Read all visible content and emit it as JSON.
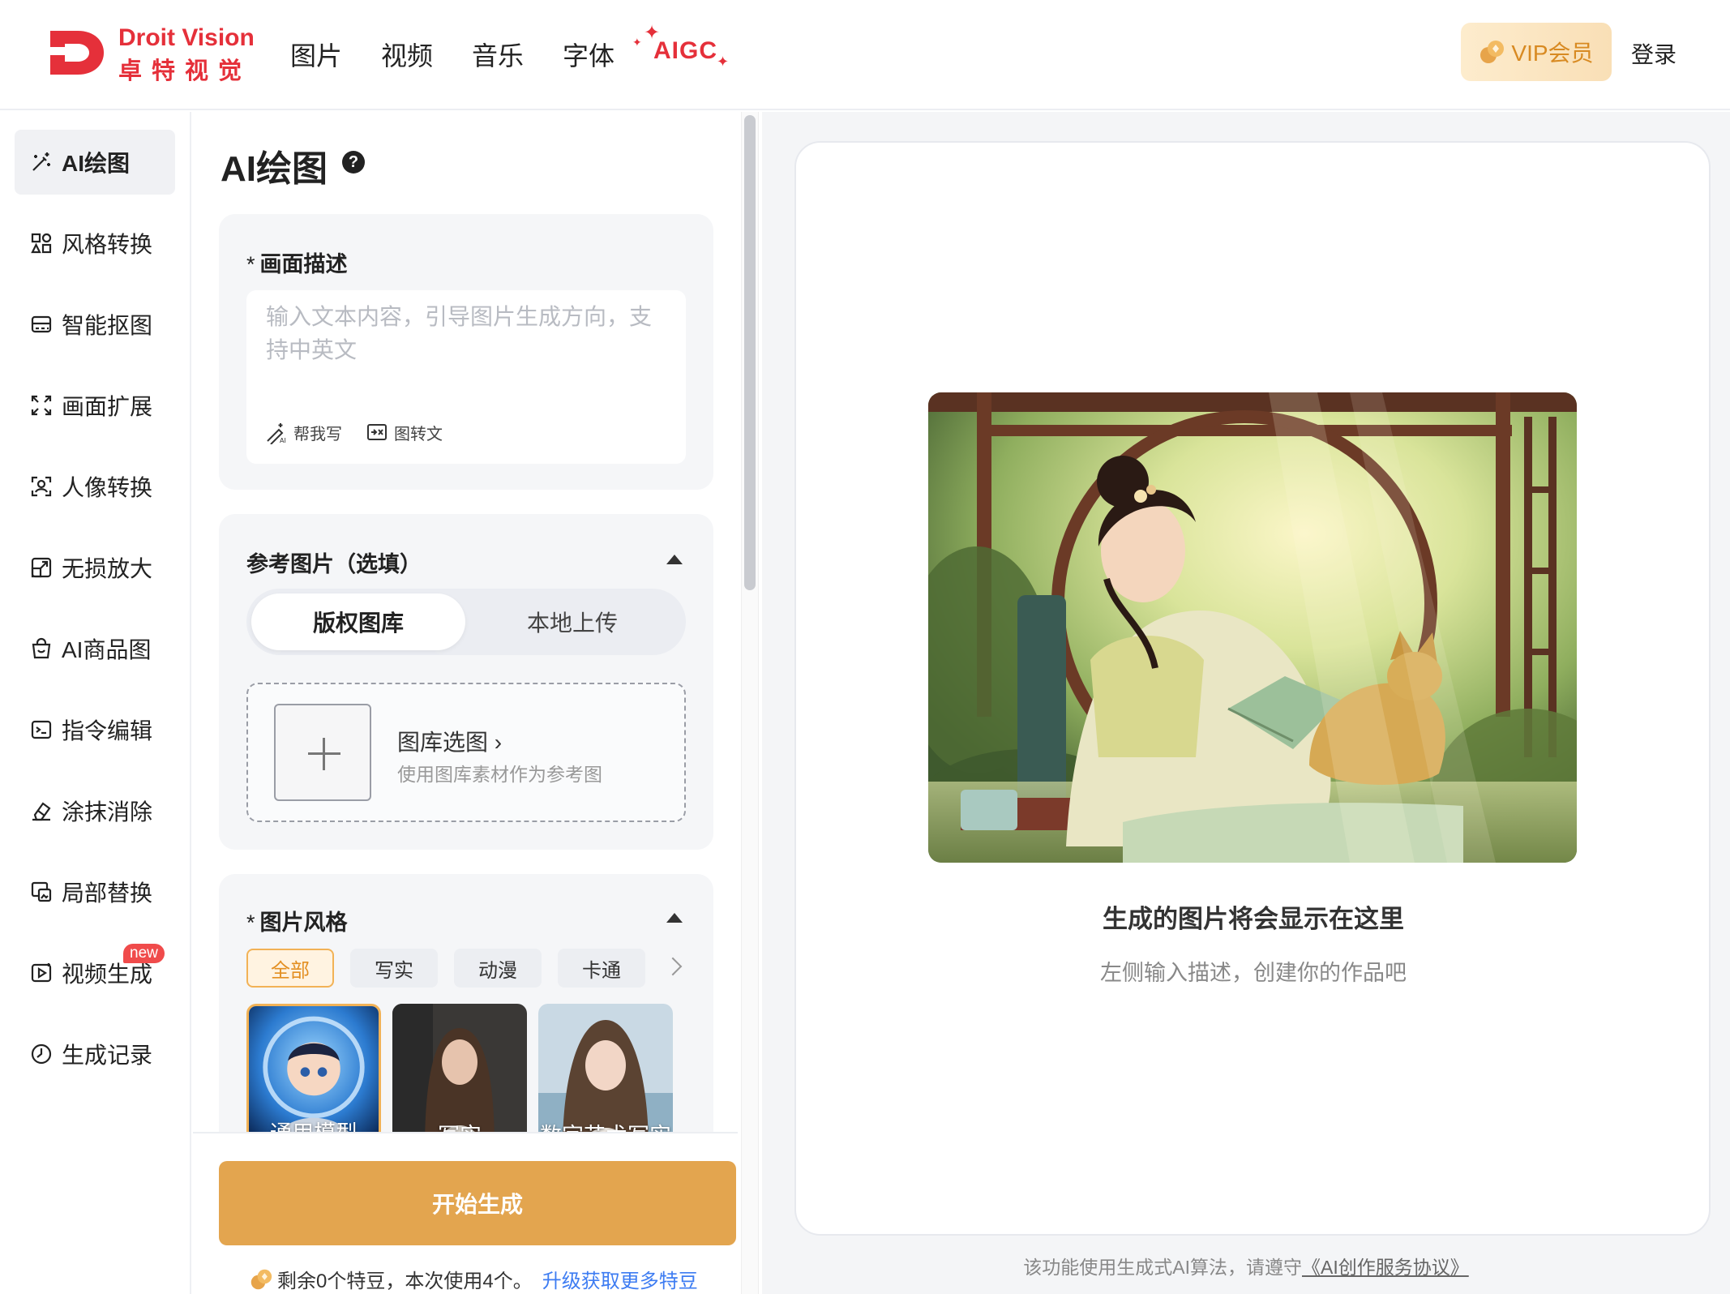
{
  "header": {
    "logo_en": "Droit Vision",
    "logo_cn": "卓特视觉",
    "nav": [
      {
        "label": "图片"
      },
      {
        "label": "视频"
      },
      {
        "label": "音乐"
      },
      {
        "label": "字体"
      }
    ],
    "aigc_label": "AIGC",
    "vip_label": "VIP会员",
    "login_label": "登录"
  },
  "sidebar": {
    "items": [
      {
        "label": "AI绘图",
        "icon": "magic-wand-icon",
        "active": true
      },
      {
        "label": "风格转换",
        "icon": "grid-style-icon"
      },
      {
        "label": "智能抠图",
        "icon": "cutout-icon"
      },
      {
        "label": "画面扩展",
        "icon": "expand-icon"
      },
      {
        "label": "人像转换",
        "icon": "portrait-scan-icon"
      },
      {
        "label": "无损放大",
        "icon": "upscale-icon"
      },
      {
        "label": "AI商品图",
        "icon": "shopping-bag-icon"
      },
      {
        "label": "指令编辑",
        "icon": "terminal-icon"
      },
      {
        "label": "涂抹消除",
        "icon": "eraser-icon"
      },
      {
        "label": "局部替换",
        "icon": "image-replace-icon"
      },
      {
        "label": "视频生成",
        "icon": "video-play-icon",
        "badge": "new"
      },
      {
        "label": "生成记录",
        "icon": "clock-icon"
      }
    ]
  },
  "panel": {
    "title": "AI绘图",
    "help_icon": "?",
    "description": {
      "required_mark": "*",
      "label": "画面描述",
      "placeholder": "输入文本内容，引导图片生成方向，支持中英文",
      "tools": [
        {
          "label": "帮我写",
          "icon": "ai-write-icon"
        },
        {
          "label": "图转文",
          "icon": "image-to-text-icon"
        }
      ]
    },
    "reference": {
      "label": "参考图片（选填）",
      "tabs": [
        {
          "label": "版权图库",
          "active": true
        },
        {
          "label": "本地上传"
        }
      ],
      "upload_title": "图库选图",
      "upload_arrow": "›",
      "upload_sub": "使用图库素材作为参考图"
    },
    "style": {
      "required_mark": "*",
      "label": "图片风格",
      "tabs": [
        {
          "label": "全部",
          "active": true
        },
        {
          "label": "写实"
        },
        {
          "label": "动漫"
        },
        {
          "label": "卡通"
        }
      ],
      "thumbnails": [
        {
          "label": "通用模型",
          "selected": true
        },
        {
          "label": "写实"
        },
        {
          "label": "数字艺术写实"
        }
      ]
    },
    "generate_label": "开始生成",
    "quota_text": "剩余0个特豆，本次使用4个。",
    "quota_link": "升级获取更多特豆"
  },
  "preview": {
    "title": "生成的图片将会显示在这里",
    "subtitle": "左侧输入描述，创建你的作品吧",
    "footer_prefix": "该功能使用生成式AI算法，请遵守",
    "footer_link": "《AI创作服务协议》"
  },
  "colors": {
    "brand_red": "#e5303a",
    "accent_orange": "#e3a54f",
    "link_blue": "#3d7cf2",
    "badge_red": "#f04b4b"
  }
}
